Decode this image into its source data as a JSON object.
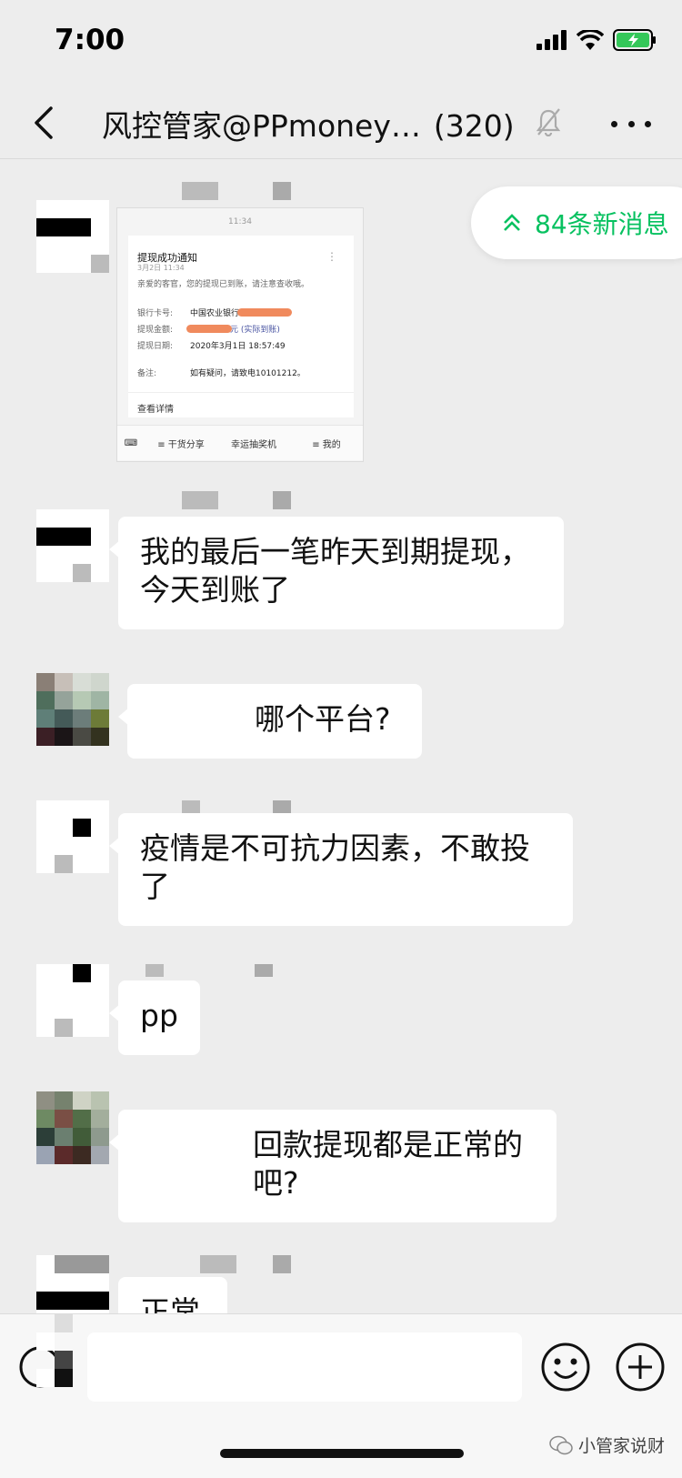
{
  "status_bar": {
    "time": "7:00"
  },
  "nav": {
    "title": "风控管家@PPmoney…",
    "count": "(320)"
  },
  "new_messages": {
    "label": "84条新消息"
  },
  "image_message": {
    "time": "11:34",
    "title": "提现成功通知",
    "date": "3月2日 11:34",
    "greeting": "亲爱的客官，您的提现已到账，请注意查收哦。",
    "rows": [
      {
        "label": "银行卡号:",
        "value": "中国农业银行"
      },
      {
        "label": "提现金额:",
        "value": "元 (实际到账)"
      },
      {
        "label": "提现日期:",
        "value": "2020年3月1日 18:57:49"
      },
      {
        "label": "备注:",
        "value": "如有疑问，请致电10101212。"
      }
    ],
    "detail_link": "查看详情",
    "menu": [
      "≡ 干货分享",
      "幸运抽奖机",
      "≡ 我的"
    ]
  },
  "messages": [
    {
      "text": "我的最后一笔昨天到期提现，今天到账了"
    },
    {
      "text": "哪个平台?"
    },
    {
      "text": "疫情是不可抗力因素，不敢投了"
    },
    {
      "text": "pp"
    },
    {
      "text": "回款提现都是正常的吧?"
    },
    {
      "text": "正常"
    }
  ],
  "watermark": {
    "text": "小管家说财"
  },
  "colors": {
    "accent": "#07c160",
    "background": "#ededed",
    "bubble": "#ffffff"
  }
}
